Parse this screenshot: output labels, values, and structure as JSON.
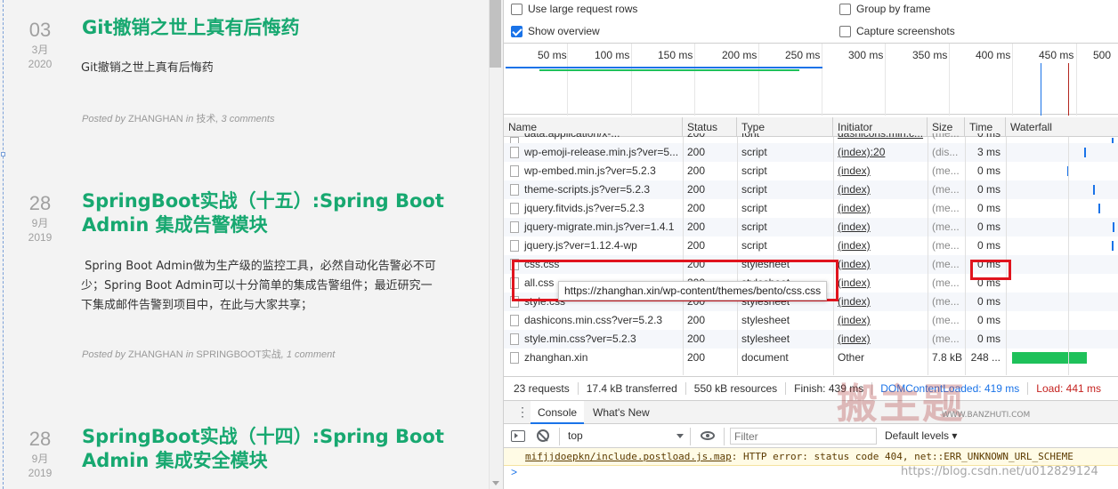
{
  "blog": {
    "posts": [
      {
        "day": "03",
        "month": "3月",
        "year": "2020",
        "title": "Git撤销之世上真有后悔药",
        "excerpt": "Git撤销之世上真有后悔药",
        "meta_prefix": "Posted by",
        "author": "ZHANGHAN",
        "meta_in": "in",
        "category": "技术",
        "comments": "3 comments"
      },
      {
        "day": "28",
        "month": "9月",
        "year": "2019",
        "title_line1": "SpringBoot实战（十五）:Spring Boot",
        "title_line2": "Admin 集成告警模块",
        "excerpt_line1": " Spring Boot Admin做为生产级的监控工具，必然自动化告警必不可",
        "excerpt_line2": "少；Spring Boot Admin可以十分简单的集成告警组件；最近研究一",
        "excerpt_line3": "下集成邮件告警到项目中，在此与大家共享；",
        "meta_prefix": "Posted by",
        "author": "ZHANGHAN",
        "meta_in": "in",
        "category": "SPRINGBOOT实战",
        "comments": "1 comment"
      },
      {
        "day": "28",
        "month": "9月",
        "year": "2019",
        "title_line1": "SpringBoot实战（十四）:Spring Boot",
        "title_line2": "Admin 集成安全模块"
      }
    ]
  },
  "devtools": {
    "options": {
      "large_rows": "Use large request rows",
      "large_rows_checked": false,
      "group_by_frame": "Group by frame",
      "group_by_frame_checked": false,
      "show_overview": "Show overview",
      "show_overview_checked": true,
      "capture_screenshots": "Capture screenshots",
      "capture_screenshots_checked": false
    },
    "overview_ticks": [
      "50 ms",
      "100 ms",
      "150 ms",
      "200 ms",
      "250 ms",
      "300 ms",
      "350 ms",
      "400 ms",
      "450 ms",
      "500"
    ],
    "columns": [
      "Name",
      "Status",
      "Type",
      "Initiator",
      "Size",
      "Time",
      "Waterfall"
    ],
    "rows": [
      {
        "name": "data:application/x-...",
        "status": "200",
        "type": "font",
        "initiator": "dashicons.min.c...",
        "size": "(me...",
        "time": "0 ms"
      },
      {
        "name": "wp-emoji-release.min.js?ver=5...",
        "status": "200",
        "type": "script",
        "initiator": "(index):20",
        "size": "(dis...",
        "time": "3 ms"
      },
      {
        "name": "wp-embed.min.js?ver=5.2.3",
        "status": "200",
        "type": "script",
        "initiator": "(index)",
        "size": "(me...",
        "time": "0 ms"
      },
      {
        "name": "theme-scripts.js?ver=5.2.3",
        "status": "200",
        "type": "script",
        "initiator": "(index)",
        "size": "(me...",
        "time": "0 ms"
      },
      {
        "name": "jquery.fitvids.js?ver=5.2.3",
        "status": "200",
        "type": "script",
        "initiator": "(index)",
        "size": "(me...",
        "time": "0 ms"
      },
      {
        "name": "jquery-migrate.min.js?ver=1.4.1",
        "status": "200",
        "type": "script",
        "initiator": "(index)",
        "size": "(me...",
        "time": "0 ms"
      },
      {
        "name": "jquery.js?ver=1.12.4-wp",
        "status": "200",
        "type": "script",
        "initiator": "(index)",
        "size": "(me...",
        "time": "0 ms"
      },
      {
        "name": "css.css",
        "status": "200",
        "type": "stylesheet",
        "initiator": "(index)",
        "size": "(me...",
        "time": "0 ms"
      },
      {
        "name": "all.css",
        "status": "200",
        "type": "stylesheet",
        "initiator": "(index)",
        "size": "(me...",
        "time": "0 ms"
      },
      {
        "name": "style.css",
        "status": "200",
        "type": "stylesheet",
        "initiator": "(index)",
        "size": "(me...",
        "time": "0 ms"
      },
      {
        "name": "dashicons.min.css?ver=5.2.3",
        "status": "200",
        "type": "stylesheet",
        "initiator": "(index)",
        "size": "(me...",
        "time": "0 ms"
      },
      {
        "name": "style.min.css?ver=5.2.3",
        "status": "200",
        "type": "stylesheet",
        "initiator": "(index)",
        "size": "(me...",
        "time": "0 ms"
      },
      {
        "name": "zhanghan.xin",
        "status": "200",
        "type": "document",
        "initiator": "Other",
        "size": "7.8 kB",
        "time": "248 ..."
      }
    ],
    "tooltip_url": "https://zhanghan.xin/wp-content/themes/bento/css.css",
    "summary": {
      "requests": "23 requests",
      "transferred": "17.4 kB transferred",
      "resources": "550 kB resources",
      "finish": "Finish: 439 ms",
      "dcl": "DOMContentLoaded: 419 ms",
      "load": "Load: 441 ms"
    },
    "drawer_tabs": [
      "Console",
      "What's New"
    ],
    "console": {
      "context": "top",
      "filter_placeholder": "Filter",
      "levels": "Default levels",
      "log_source": "mifjjdoepkn/include.postload.js.map",
      "log_text": ": HTTP error: status code 404, net::ERR_UNKNOWN_URL_SCHEME",
      "prompt": ">"
    }
  },
  "watermark": {
    "site": "WWW.BANZHUTI.COM",
    "csdn": "https://blog.csdn.net/u012829124"
  },
  "colors": {
    "accent_green": "#17a870",
    "devtools_blue": "#1a73e8",
    "highlight_red": "#e0141e"
  }
}
